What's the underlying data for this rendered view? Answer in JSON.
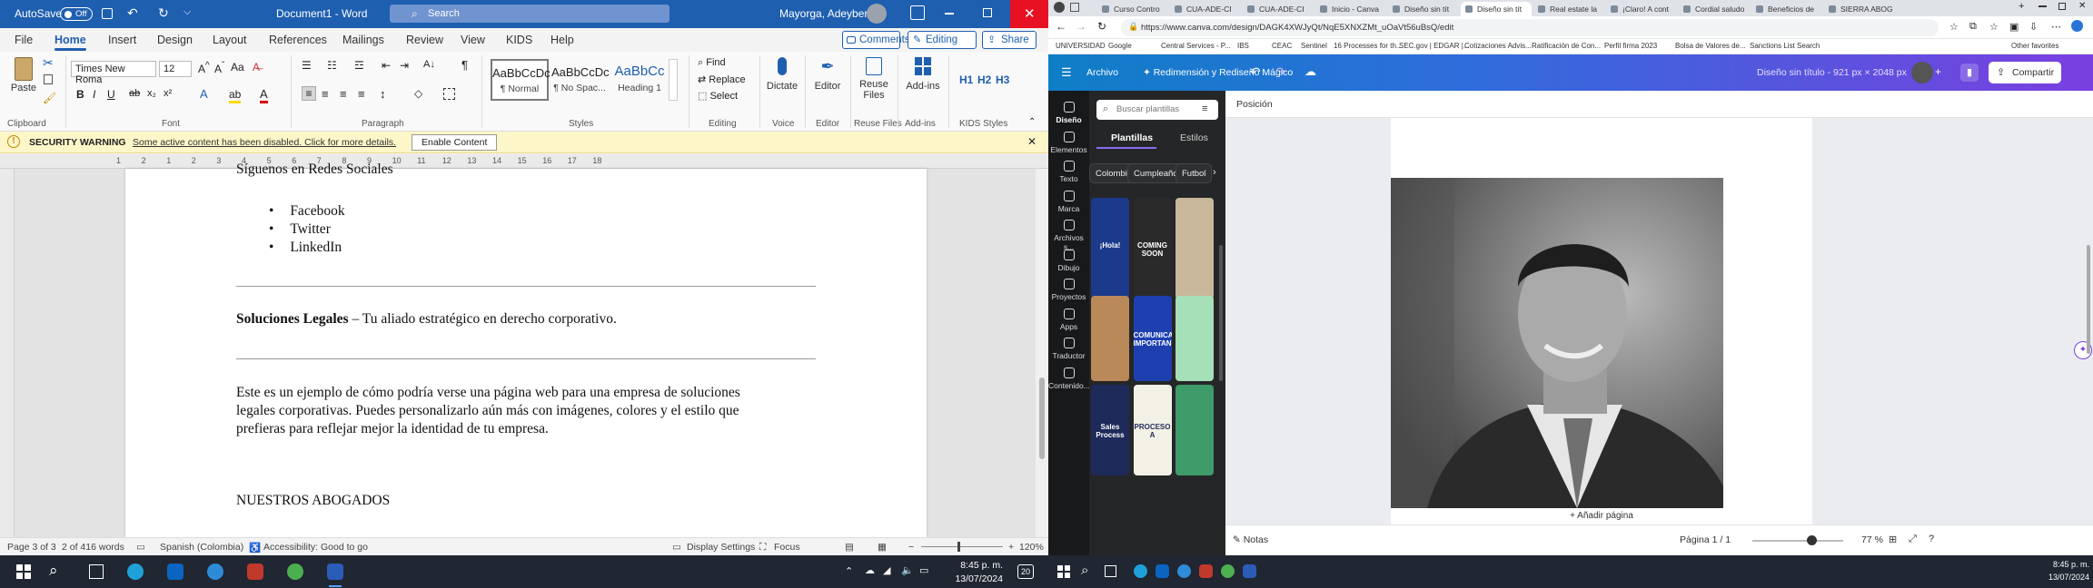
{
  "word": {
    "titlebar": {
      "autosave_label": "AutoSave",
      "autosave_state": "Off",
      "doc_title": "Document1 - Word",
      "search_placeholder": "Search",
      "user_name": "Mayorga, Adeyber"
    },
    "tabs": [
      "File",
      "Home",
      "Insert",
      "Design",
      "Layout",
      "References",
      "Mailings",
      "Review",
      "View",
      "KIDS",
      "Help"
    ],
    "active_tab": "Home",
    "comments_label": "Comments",
    "editing_label": "Editing",
    "share_label": "Share",
    "ribbon": {
      "paste_label": "Paste",
      "font_name": "Times New Roma",
      "font_size": "12",
      "styles": [
        {
          "preview": "AaBbCcDc",
          "name": "¶ Normal"
        },
        {
          "preview": "AaBbCcDc",
          "name": "¶ No Spac..."
        },
        {
          "preview": "AaBbCc",
          "name": "Heading 1"
        }
      ],
      "find_label": "Find",
      "replace_label": "Replace",
      "select_label": "Select",
      "dictate_label": "Dictate",
      "editor_label": "Editor",
      "reuse_label": "Reuse Files",
      "addins_label": "Add-ins",
      "h1_label": "H1",
      "h2_label": "H2",
      "h3_label": "H3",
      "groups": [
        "Clipboard",
        "Font",
        "Paragraph",
        "Styles",
        "Editing",
        "Voice",
        "Editor",
        "Reuse Files",
        "Add-ins",
        "KIDS Styles"
      ]
    },
    "warning": {
      "title": "SECURITY WARNING",
      "message": "Some active content has been disabled. Click for more details.",
      "button": "Enable Content"
    },
    "ruler_numbers": [
      "1",
      "2",
      "1",
      "2",
      "3",
      "4",
      "5",
      "6",
      "7",
      "8",
      "9",
      "10",
      "11",
      "12",
      "13",
      "14",
      "15",
      "16",
      "17",
      "18"
    ],
    "document": {
      "heading_partial": "Síguenos en Redes Sociales",
      "social_links": [
        "Facebook",
        "Twitter",
        "LinkedIn"
      ],
      "tagline_bold": "Soluciones Legales",
      "tagline_rest": " – Tu aliado estratégico en derecho corporativo.",
      "paragraph_lines": [
        "Este es un ejemplo de cómo podría verse una página web para una empresa de soluciones",
        "legales corporativas. Puedes personalizarlo aún más con imágenes, colores y el estilo que",
        "prefieras para reflejar mejor la identidad de tu empresa."
      ],
      "section_title": "NUESTROS ABOGADOS"
    },
    "status": {
      "page": "Page 3 of 3",
      "words": "2 of 416 words",
      "language": "Spanish (Colombia)",
      "accessibility": "Accessibility: Good to go",
      "display_settings": "Display Settings",
      "focus": "Focus",
      "zoom": "120%"
    }
  },
  "chrome": {
    "tabs": [
      "Curso Contro",
      "CUA-ADE-CI",
      "CUA-ADE-CI",
      "Inicio - Canva",
      "Diseño sin tít",
      "Diseño sin tít",
      "Real estate la",
      "¡Claro! A cont",
      "Cordial saludo",
      "Beneficios de",
      "SIERRA ABOG"
    ],
    "active_tab_index": 5,
    "url": "https://www.canva.com/design/DAGK4XWJyQt/NqE5XNXZMt_uOaVt56uBsQ/edit",
    "bookmarks": [
      "UNIVERSIDAD",
      "Google",
      "Central Services - P...",
      "IBS",
      "CEAC",
      "Sentinel",
      "16 Processes for th...",
      "SEC.gov | EDGAR |...",
      "Cotizaciones Advis...",
      "Ratificación de Con...",
      "Perfil firma 2023",
      "Bolsa de Valores de...",
      "Sanctions List Search"
    ],
    "other_favorites": "Other favorites"
  },
  "canva": {
    "menu": {
      "archivo": "Archivo",
      "project": "Redimensión y Rediseño Mágico"
    },
    "design_title": "Diseño sin título - 921 px × 2048 px",
    "share_label": "Compartir",
    "rail": [
      "Diseño",
      "Elementos",
      "Texto",
      "Marca",
      "Archivos s...",
      "Dibujo",
      "Proyectos",
      "Apps",
      "Traductor",
      "Contenido..."
    ],
    "search_placeholder": "Buscar plantillas",
    "panel_tabs": [
      "Plantillas",
      "Estilos"
    ],
    "chips": [
      "Colombia",
      "Cumpleaños",
      "Futbol"
    ],
    "templates": [
      {
        "text": "¡Hola!",
        "color": "#1b3a8c"
      },
      {
        "text": "COMING SOON",
        "color": "#2a2a2a"
      },
      {
        "text": "",
        "color": "#c9b79b"
      },
      {
        "text": "",
        "color": "#b9895a"
      },
      {
        "text": "COMUNICADO IMPORTANTE",
        "color": "#1d3fb0"
      },
      {
        "text": "",
        "color": "#a6e0b8"
      },
      {
        "text": "Sales Process",
        "color": "#1e2a5a"
      },
      {
        "text": "PROCESO A",
        "color": "#f3f1e6"
      },
      {
        "text": "",
        "color": "#3e9b6a"
      }
    ],
    "position_label": "Posición",
    "add_page": "+ Añadir página",
    "notes_label": "Notas",
    "page_indicator": "Página 1 / 1",
    "zoom": "77 %"
  },
  "taskbar_left": {
    "time": "8:45 p. m.",
    "date": "13/07/2024",
    "badge": "20"
  },
  "taskbar_right": {
    "time": "8:45 p. m.",
    "date": "13/07/2024"
  },
  "colors": {
    "word_blue": "#1e5fb0",
    "warning_bg": "#fdf6c8",
    "canva_purple": "#7a3fe0",
    "taskbar": "#202632"
  }
}
